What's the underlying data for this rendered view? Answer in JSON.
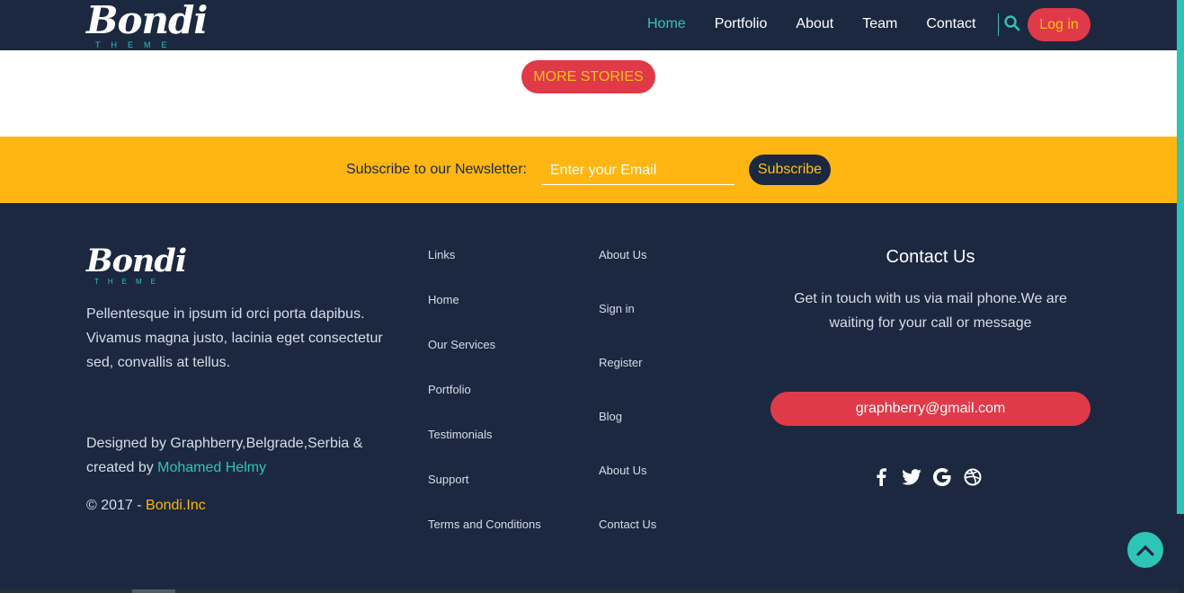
{
  "nav": {
    "logo_word": "Bondi",
    "logo_sub": "THEME",
    "links": [
      "Home",
      "Portfolio",
      "About",
      "Team",
      "Contact"
    ],
    "login_label": "Log in"
  },
  "hero": {
    "more_stories_label": "MORE STORIES"
  },
  "newsletter": {
    "label": "Subscribe to our Newsletter:",
    "email_placeholder": "Enter your Email",
    "button_label": "Subscribe"
  },
  "footer": {
    "logo_word": "Bondi",
    "logo_sub": "THEME",
    "description": "Pellentesque in ipsum id orci porta dapibus. Vivamus magna justo, lacinia eget consectetur sed, convallis at tellus.",
    "credit_prefix": "Designed by Graphberry,Belgrade,Serbia & created by ",
    "credit_author": "Mohamed Helmy",
    "copyright_prefix": "© 2017 - ",
    "copyright_brand": "Bondi.Inc",
    "links_col1": [
      "Links",
      "Home",
      "Our Services",
      "Portfolio",
      "Testimonials",
      "Support",
      "Terms and Conditions"
    ],
    "links_col2": [
      "About Us",
      "Sign in",
      "Register",
      "Blog",
      "About Us",
      "Contact Us"
    ],
    "contact_title": "Contact Us",
    "contact_text": "Get in touch with us via mail phone.We are waiting for your call or message",
    "email": "graphberry@gmail.com",
    "socials": [
      "facebook-icon",
      "twitter-icon",
      "google-icon",
      "dribbble-icon"
    ]
  },
  "colors": {
    "navy": "#1b2840",
    "teal": "#2ec4b6",
    "red": "#e03a49",
    "yellow": "#ffb612"
  }
}
